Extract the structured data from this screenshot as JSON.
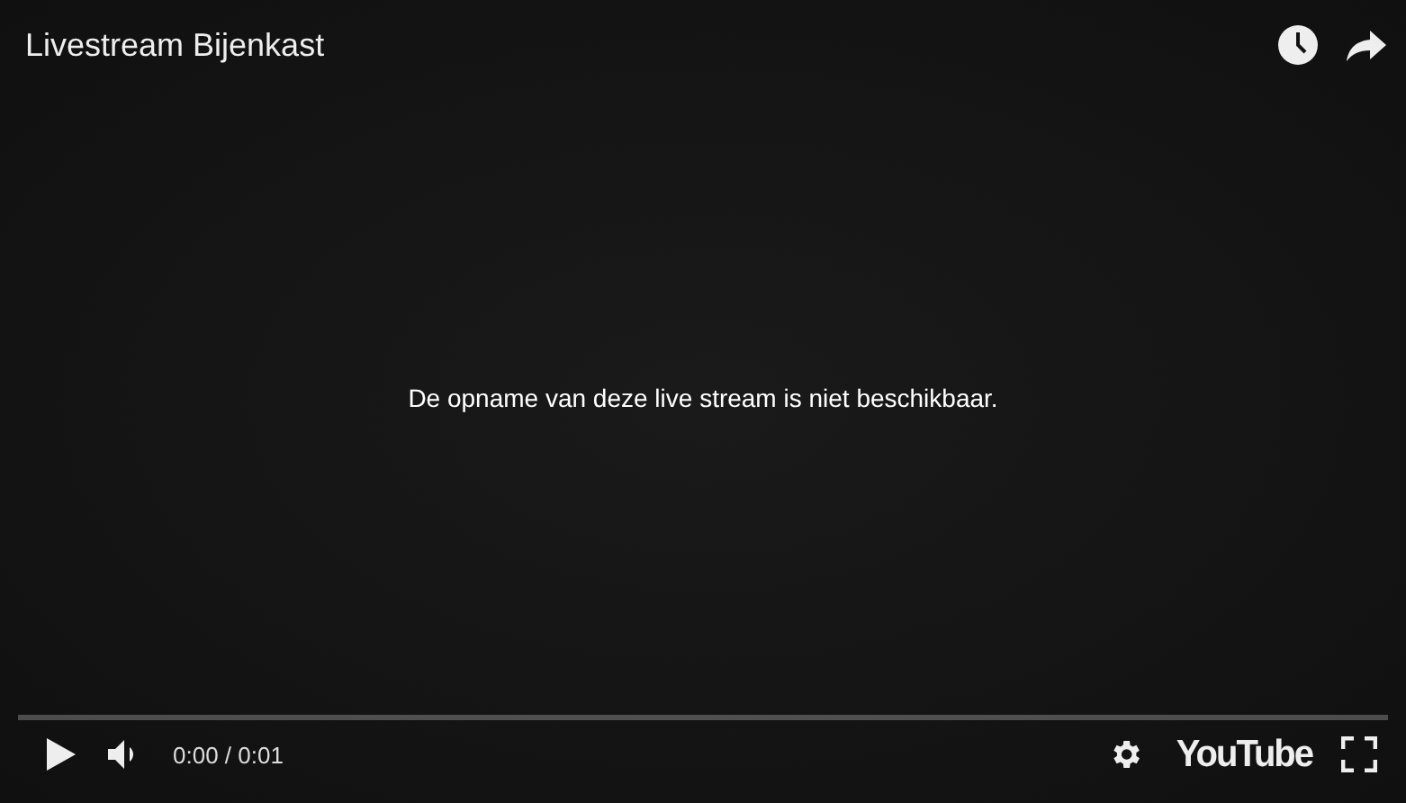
{
  "video": {
    "title": "Livestream Bijenkast",
    "message": "De opname van deze live stream is niet beschikbaar."
  },
  "controls": {
    "time": "0:00 / 0:01",
    "logo": "YouTube"
  }
}
